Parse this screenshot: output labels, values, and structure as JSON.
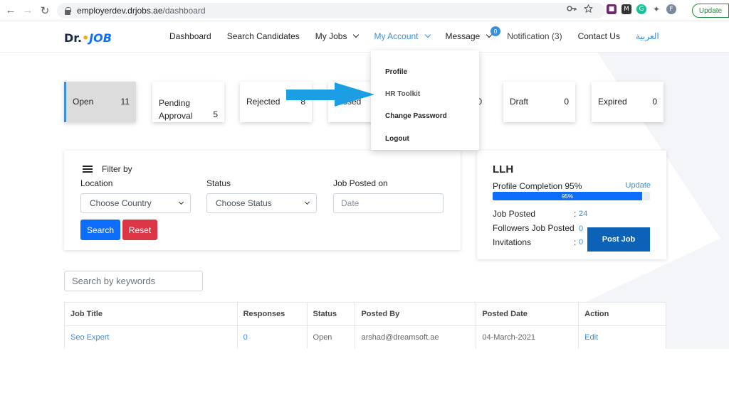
{
  "browser": {
    "back_icon": "←",
    "forward_icon": "→",
    "reload_icon": "↻",
    "url_host": "employerdev.drjobs.ae",
    "url_path": "/dashboard",
    "update_label": "Update"
  },
  "header": {
    "logo_prefix": "Dr.",
    "logo_suffix": "JOB",
    "nav": {
      "dashboard": "Dashboard",
      "search_candidates": "Search Candidates",
      "my_jobs": "My Jobs",
      "my_account": "My Account",
      "message": "Message",
      "message_badge": "0",
      "notification": "Notification (3)",
      "contact_us": "Contact Us",
      "arabic": "العربية"
    }
  },
  "status_cards": {
    "open": {
      "label": "Open",
      "count": "11"
    },
    "pending": {
      "label_line1": "Pending",
      "label_line2": "Approval",
      "count": "5"
    },
    "rejected": {
      "label": "Rejected",
      "count": "8"
    },
    "closed": {
      "label": "Closed",
      "count": "0"
    },
    "draft": {
      "label": "Draft",
      "count": "0"
    },
    "expired": {
      "label": "Expired",
      "count": "0"
    }
  },
  "filter": {
    "title": "Filter by",
    "location_label": "Location",
    "location_value": "Choose Country",
    "status_label": "Status",
    "status_value": "Choose Status",
    "posted_label": "Job Posted on",
    "date_placeholder": "Date",
    "search_btn": "Search",
    "reset_btn": "Reset"
  },
  "profile": {
    "company": "LLH",
    "completion_label": "Profile Completion 95%",
    "update_link": "Update",
    "completion_pct": 0.95,
    "progress_text": "95%",
    "job_posted_label": "Job Posted",
    "job_posted_value": "24",
    "followers_label": "Followers Job Posted",
    "followers_value": "0",
    "invitations_label": "Invitations",
    "invitations_value": "0",
    "colon": ":",
    "post_job_btn": "Post Job"
  },
  "search": {
    "placeholder": "Search by keywords"
  },
  "table": {
    "headers": [
      "Job Title",
      "Responses",
      "Status",
      "Posted By",
      "Posted Date",
      "Action"
    ],
    "rows": [
      [
        "Seo Expert",
        "0",
        "Open",
        "arshad@dreamsoft.ae",
        "04-March-2021",
        "Edit"
      ]
    ]
  },
  "dropdown": {
    "items": [
      "Profile",
      "HR Toolkit",
      "Change Password",
      "Logout"
    ]
  },
  "colors": {
    "accent": "#3b8fd8",
    "primary": "#0d6efd",
    "danger": "#dc3545",
    "arrow": "#1b9ee3"
  }
}
